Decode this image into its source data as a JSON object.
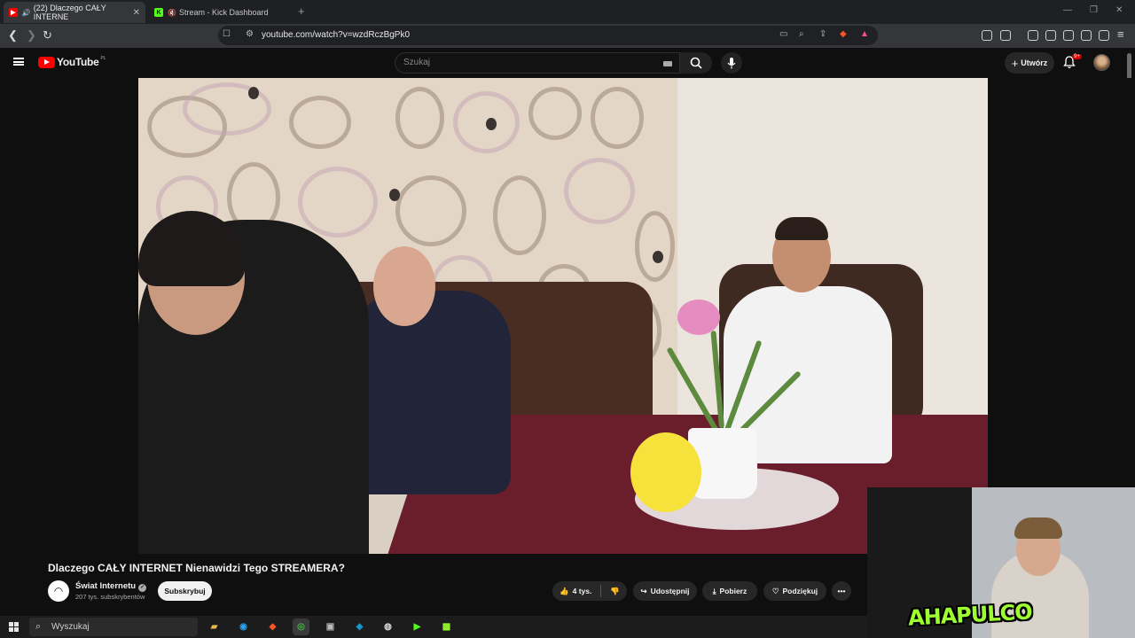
{
  "browser": {
    "tabs": [
      {
        "title": "(22) Dlaczego CAŁY INTERNE",
        "active": true,
        "favicon": "youtube-icon"
      },
      {
        "title": "Stream - Kick Dashboard",
        "active": false,
        "favicon": "kick-icon"
      }
    ],
    "url": "youtube.com/watch?v=wzdRczBgPk0"
  },
  "youtube": {
    "logo_text": "YouTube",
    "region": "PL",
    "search_placeholder": "Szukaj",
    "create_label": "Utwórz",
    "notifications_badge": "9+"
  },
  "video": {
    "title": "Dlaczego CAŁY INTERNET Nienawidzi Tego STREAMERA?",
    "channel": "Świat Internetu",
    "subscribers": "207 tys. subskrybentów",
    "subscribe_label": "Subskrybuj",
    "likes": "4 tys.",
    "share_label": "Udostępnij",
    "download_label": "Pobierz",
    "thanks_label": "Podziękuj"
  },
  "overlay": {
    "logo_text": "AHAPULCO"
  },
  "taskbar": {
    "search_placeholder": "Wyszukaj"
  },
  "colors": {
    "yt_red": "#ff0000",
    "background": "#0f0f0f",
    "overlay_logo": "#9dff2f"
  }
}
